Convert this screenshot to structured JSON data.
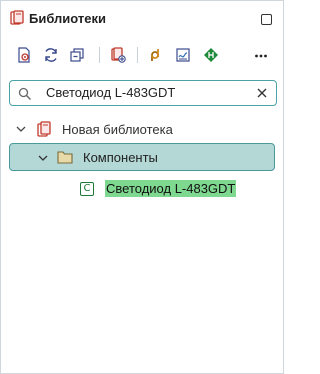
{
  "panel": {
    "title": "Библиотеки"
  },
  "toolbar": {
    "items": [
      {
        "icon": "preview-icon"
      },
      {
        "icon": "refresh-icon"
      },
      {
        "icon": "collapse-all-icon"
      },
      {
        "icon": "add-library-icon"
      },
      {
        "icon": "link-icon"
      },
      {
        "icon": "graph-icon"
      },
      {
        "icon": "component-diagram-icon"
      },
      {
        "icon": "more-icon"
      }
    ]
  },
  "search": {
    "value": "Светодиод L-483GDT",
    "placeholder": ""
  },
  "tree": {
    "library": {
      "label": "Новая библиотека",
      "expanded": true
    },
    "folder": {
      "label": "Компоненты",
      "expanded": true,
      "selected": true
    },
    "component": {
      "badge": "C",
      "label": "Светодиод L-483GDT",
      "highlighted": true
    }
  },
  "colors": {
    "accent": "#4aa3a6",
    "selection_bg": "#b3d8d6",
    "match_highlight": "#7fd88f",
    "library_red": "#c0392b",
    "component_green": "#1e7a3a"
  }
}
